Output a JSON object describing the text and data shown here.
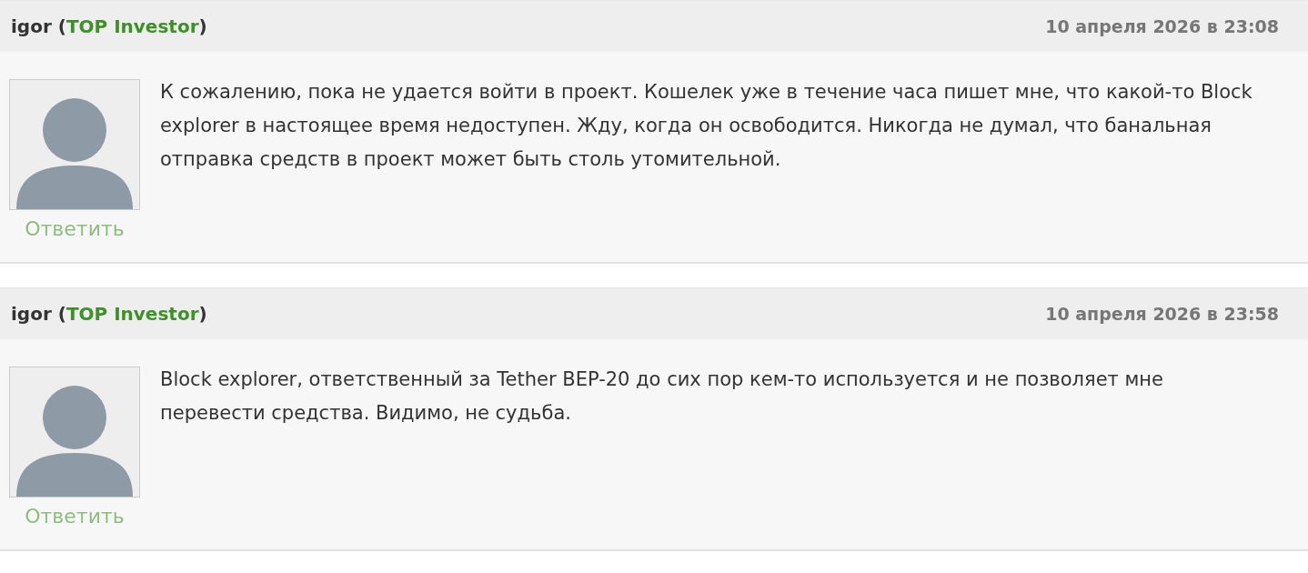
{
  "comments": [
    {
      "author": "igor",
      "role_open": "(",
      "role": "TOP Investor",
      "role_close": ")",
      "date": "10 апреля 2026 в 23:08",
      "text": "К сожалению, пока не удается войти в проект. Кошелек уже в течение часа пишет мне, что какой-то Block explorer в настоящее время недоступен. Жду, когда он освободится. Никогда не думал, что банальная отправка средств в проект может быть столь утомительной.",
      "reply": "Ответить"
    },
    {
      "author": "igor",
      "role_open": "(",
      "role": "TOP Investor",
      "role_close": ")",
      "date": "10 апреля 2026 в 23:58",
      "text": "Block explorer, ответственный за Tether BEP-20 до сих пор кем-то используется и не позволяет мне перевести средства. Видимо, не судьба.",
      "reply": "Ответить"
    }
  ]
}
